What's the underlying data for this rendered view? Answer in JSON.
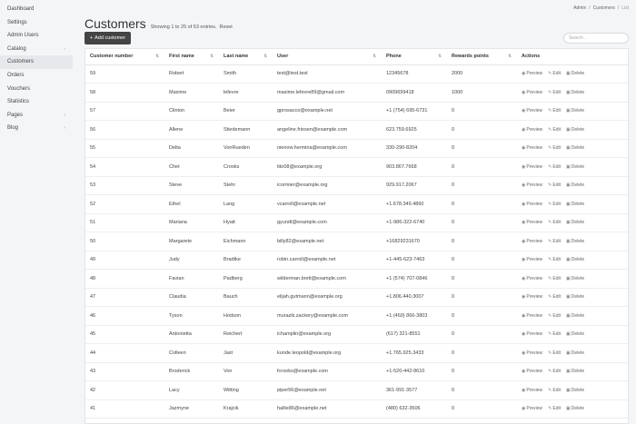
{
  "sidebar": {
    "items": [
      {
        "label": "Dashboard",
        "chevron": false,
        "active": false
      },
      {
        "label": "Settings",
        "chevron": false,
        "active": false
      },
      {
        "label": "Admin Users",
        "chevron": false,
        "active": false
      },
      {
        "label": "Catalog",
        "chevron": true,
        "active": false
      },
      {
        "label": "Customers",
        "chevron": false,
        "active": true
      },
      {
        "label": "Orders",
        "chevron": false,
        "active": false
      },
      {
        "label": "Vouchers",
        "chevron": false,
        "active": false
      },
      {
        "label": "Statistics",
        "chevron": false,
        "active": false
      },
      {
        "label": "Pages",
        "chevron": true,
        "active": false
      },
      {
        "label": "Blog",
        "chevron": true,
        "active": false
      }
    ]
  },
  "breadcrumb": {
    "admin": "Admin",
    "customers": "Customers",
    "current": "List",
    "sep": "/"
  },
  "header": {
    "title": "Customers",
    "entries": "Showing 1 to 25 of 53 entries.",
    "reset": "Reset",
    "add_label": "Add customer",
    "search_placeholder": "Search..."
  },
  "table": {
    "columns": [
      "Customer number",
      "First name",
      "Last name",
      "User",
      "Phone",
      "Rewards points",
      "Actions"
    ],
    "actions": {
      "preview": "Preview",
      "edit": "Edit",
      "delete": "Delete"
    },
    "rows": [
      [
        "59",
        "Robert",
        "Smith",
        "test@test.test",
        "12345678",
        "2000"
      ],
      [
        "58",
        "Maxime",
        "lefevre",
        "maxime.lefevre89@gmail.com",
        "0909699418",
        "1000"
      ],
      [
        "57",
        "Clinton",
        "Beier",
        "gprosacco@example.net",
        "+1 (754) 695-6731",
        "0"
      ],
      [
        "56",
        "Allene",
        "Stiedemann",
        "angeline.friesen@example.com",
        "623.759.6925",
        "0"
      ],
      [
        "55",
        "Delta",
        "VonRueden",
        "nienow.hermina@example.com",
        "330-290-8204",
        "0"
      ],
      [
        "54",
        "Chet",
        "Crooks",
        "tito08@example.org",
        "903.867.7668",
        "0"
      ],
      [
        "53",
        "Steve",
        "Stehr",
        "icormier@example.org",
        "929.917.2067",
        "0"
      ],
      [
        "52",
        "Ethel",
        "Lang",
        "vcarroll@example.net",
        "+1.678.349.4860",
        "0"
      ],
      [
        "51",
        "Mariana",
        "Hyatt",
        "gyundt@example.com",
        "+1-986-322-6740",
        "0"
      ],
      [
        "50",
        "Margarete",
        "Eichmann",
        "billy82@example.net",
        "+16829231670",
        "0"
      ],
      [
        "49",
        "Judy",
        "Bradtke",
        "robin.carroll@example.net",
        "+1-445-623-7463",
        "0"
      ],
      [
        "48",
        "Favian",
        "Padberg",
        "wilderman.brett@example.com",
        "+1 (574) 707-0846",
        "0"
      ],
      [
        "47",
        "Claudia",
        "Bauch",
        "elijah.gutmann@example.org",
        "+1.806.440.3007",
        "0"
      ],
      [
        "46",
        "Tyson",
        "Hodson",
        "murazik.zackery@example.com",
        "+1 (469) 866-3803",
        "0"
      ],
      [
        "45",
        "Antonietta",
        "Reichert",
        "ichamplin@example.org",
        "(617) 321-8551",
        "0"
      ],
      [
        "44",
        "Colleen",
        "Jast",
        "kunde.leopold@example.org",
        "+1.765.925.3433",
        "0"
      ],
      [
        "43",
        "Broderick",
        "Von",
        "fcrooks@example.com",
        "+1-520-442-8610",
        "0"
      ],
      [
        "42",
        "Lacy",
        "Witting",
        "piper56@example.net",
        "361-991-3577",
        "0"
      ],
      [
        "41",
        "Jazmyne",
        "Krajcik",
        "hallie86@example.net",
        "(480) 632-3506",
        "0"
      ]
    ]
  }
}
